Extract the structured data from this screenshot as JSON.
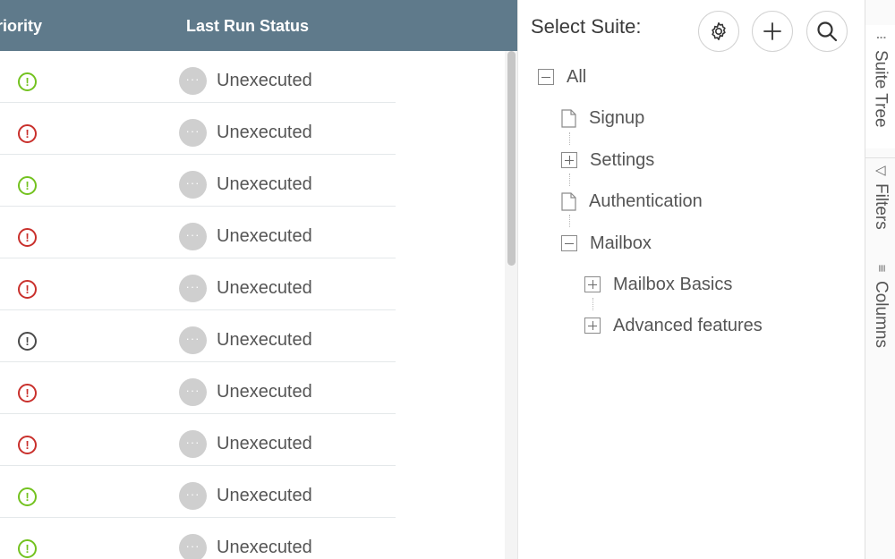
{
  "grid": {
    "columns": {
      "priority": "riority",
      "last_run_status": "Last Run Status"
    },
    "rows": [
      {
        "priority": "low",
        "priority_icon": "!",
        "status_icon": "···",
        "status": "Unexecuted"
      },
      {
        "priority": "high",
        "priority_icon": "!",
        "status_icon": "···",
        "status": "Unexecuted"
      },
      {
        "priority": "low",
        "priority_icon": "!",
        "status_icon": "···",
        "status": "Unexecuted"
      },
      {
        "priority": "high",
        "priority_icon": "!",
        "status_icon": "···",
        "status": "Unexecuted"
      },
      {
        "priority": "high",
        "priority_icon": "!",
        "status_icon": "···",
        "status": "Unexecuted"
      },
      {
        "priority": "normal",
        "priority_icon": "!",
        "status_icon": "···",
        "status": "Unexecuted"
      },
      {
        "priority": "high",
        "priority_icon": "!",
        "status_icon": "···",
        "status": "Unexecuted"
      },
      {
        "priority": "high",
        "priority_icon": "!",
        "status_icon": "···",
        "status": "Unexecuted"
      },
      {
        "priority": "low",
        "priority_icon": "!",
        "status_icon": "···",
        "status": "Unexecuted"
      },
      {
        "priority": "low",
        "priority_icon": "!",
        "status_icon": "···",
        "status": "Unexecuted"
      }
    ]
  },
  "suite_panel": {
    "title": "Select Suite:",
    "buttons": {
      "settings": "gear-icon",
      "add": "plus-icon",
      "search": "search-icon"
    },
    "tree": {
      "all": {
        "label": "All",
        "state": "expanded"
      },
      "signup": {
        "label": "Signup",
        "type": "leaf"
      },
      "settings": {
        "label": "Settings",
        "state": "collapsed"
      },
      "authentication": {
        "label": "Authentication",
        "type": "leaf"
      },
      "mailbox": {
        "label": "Mailbox",
        "state": "expanded"
      },
      "mailbox_basics": {
        "label": "Mailbox Basics",
        "state": "collapsed"
      },
      "advanced_features": {
        "label": "Advanced features",
        "state": "collapsed"
      }
    }
  },
  "side_tabs": {
    "suite_tree": {
      "icon": "⁝",
      "label": "Suite Tree"
    },
    "filters": {
      "icon": "▽",
      "label": "Filters"
    },
    "columns": {
      "icon": "≡",
      "label": "Columns"
    }
  },
  "colors": {
    "header_bg": "#5f7a8b",
    "priority_high": "#c9302c",
    "priority_low": "#73c21f",
    "priority_normal": "#4a4a4a",
    "status_dot": "#cfcfcf"
  }
}
